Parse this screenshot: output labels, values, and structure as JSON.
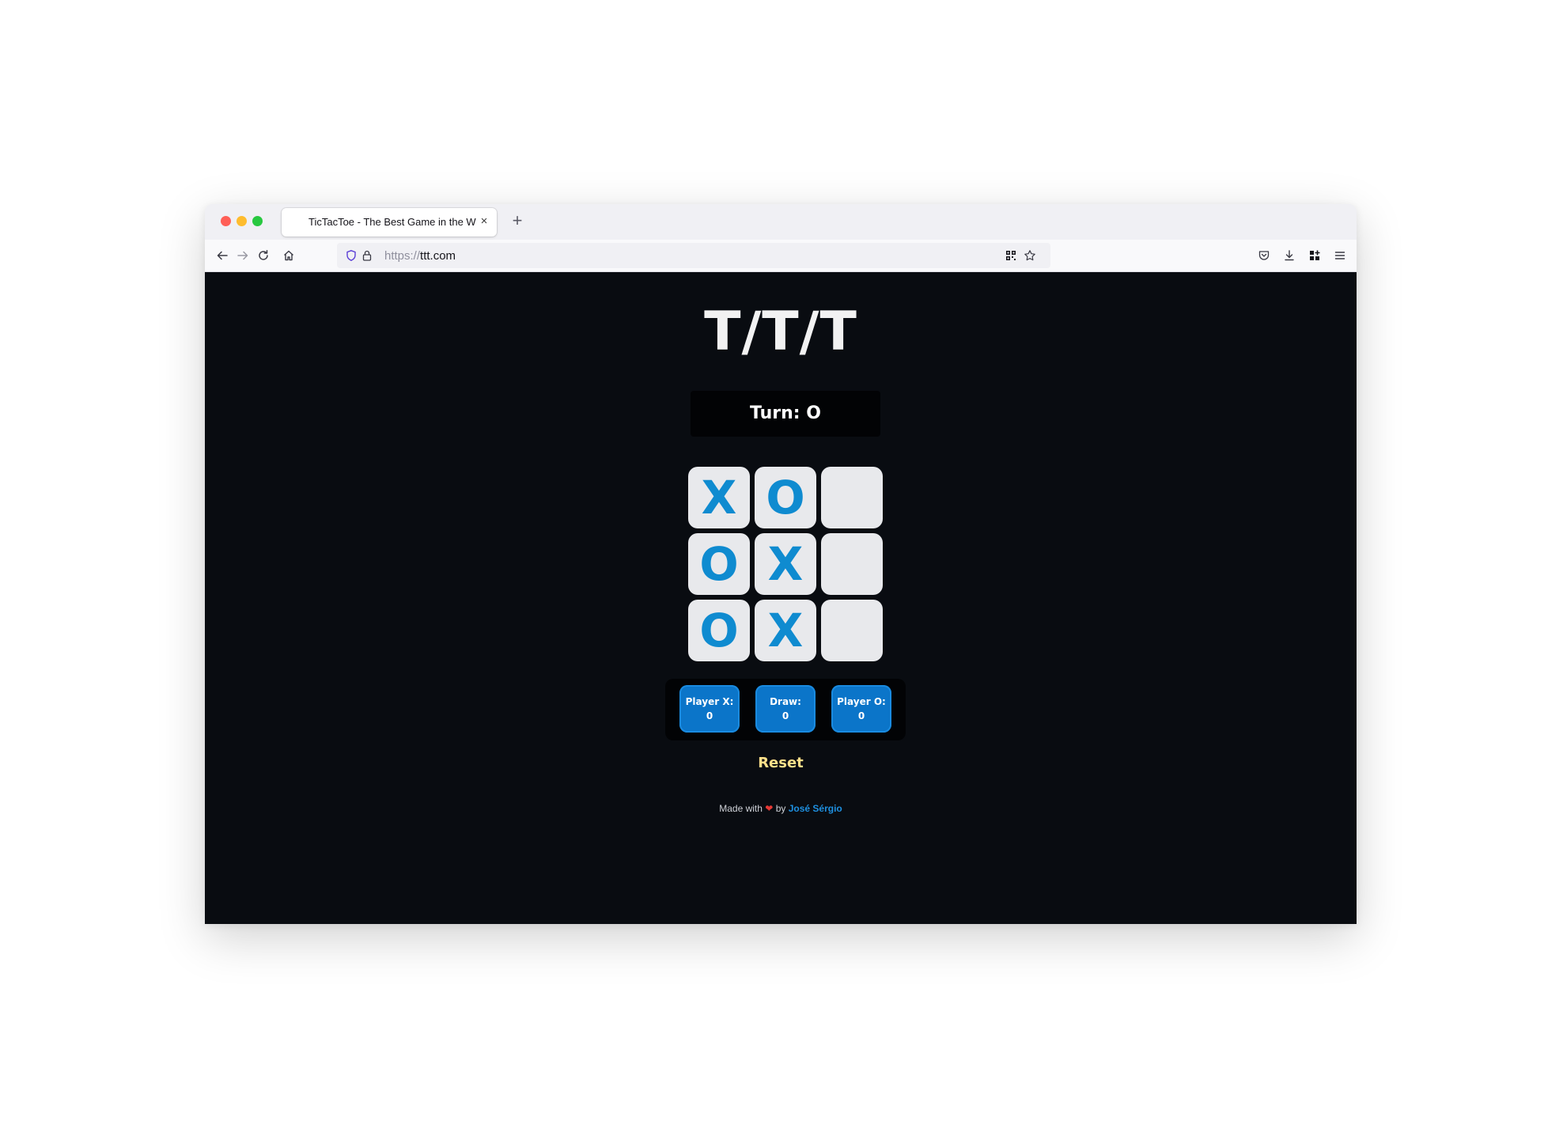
{
  "browser": {
    "tab_title": "TicTacToe - The Best Game in the Wo",
    "tab_close": "×",
    "new_tab": "+",
    "url_scheme": "https://",
    "url_host": "ttt.com"
  },
  "app": {
    "logo": "T/T/T",
    "turn_text": "Turn: O",
    "board": [
      "X",
      "O",
      "",
      "O",
      "X",
      "",
      "O",
      "X",
      ""
    ],
    "scores": [
      {
        "label": "Player X:",
        "value": "0"
      },
      {
        "label": "Draw:",
        "value": "0"
      },
      {
        "label": "Player O:",
        "value": "0"
      }
    ],
    "reset_label": "Reset",
    "footer": {
      "made_with": "Made with",
      "heart": "❤",
      "by": "by",
      "author": "José Sérgio"
    }
  },
  "colors": {
    "page_bg": "#090c11",
    "mark": "#0f8bd0",
    "score_button": "#0b75c9",
    "reset": "#ffe08a",
    "author_link": "#1e90e0"
  }
}
